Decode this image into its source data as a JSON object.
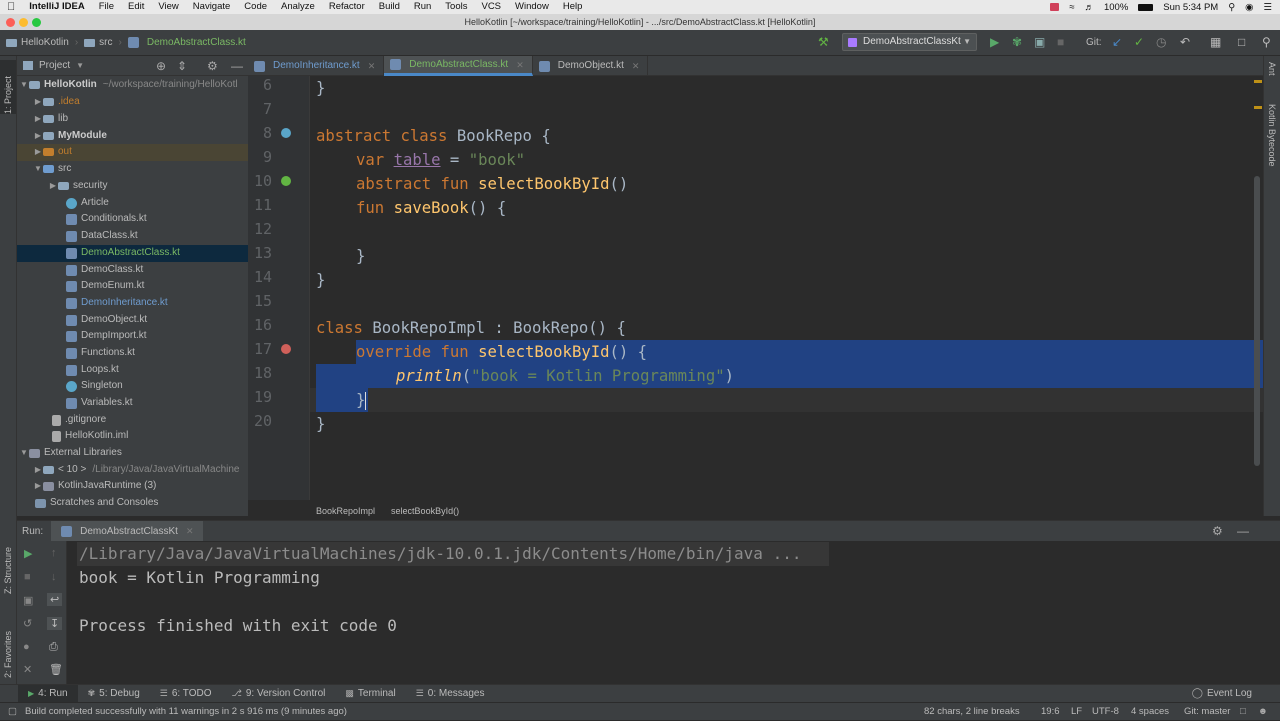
{
  "menubar": {
    "apple": "",
    "items": [
      "IntelliJ IDEA",
      "File",
      "Edit",
      "View",
      "Navigate",
      "Code",
      "Analyze",
      "Refactor",
      "Build",
      "Run",
      "Tools",
      "VCS",
      "Window",
      "Help"
    ],
    "battery": "100%",
    "clock": "Sun 5:34 PM"
  },
  "window_title": "HelloKotlin [~/workspace/training/HelloKotlin] - .../src/DemoAbstractClass.kt [HelloKotlin]",
  "navbar": {
    "crumbs": [
      "HelloKotlin",
      "src",
      "DemoAbstractClass.kt"
    ],
    "run_config": "DemoAbstractClassKt",
    "git_label": "Git:"
  },
  "left_strip": {
    "project": "1: Project",
    "structure": "Z: Structure",
    "favorites": "2: Favorites"
  },
  "right_strip": {
    "ant": "Ant",
    "bytecode": "Kotlin Bytecode"
  },
  "project_panel": {
    "title": "Project",
    "tree": [
      {
        "label": "HelloKotlin",
        "extra": "~/workspace/training/HelloKotl"
      },
      {
        "label": ".idea"
      },
      {
        "label": "lib"
      },
      {
        "label": "MyModule"
      },
      {
        "label": "out"
      },
      {
        "label": "src"
      },
      {
        "label": "security"
      },
      {
        "label": "Article"
      },
      {
        "label": "Conditionals.kt"
      },
      {
        "label": "DataClass.kt"
      },
      {
        "label": "DemoAbstractClass.kt"
      },
      {
        "label": "DemoClass.kt"
      },
      {
        "label": "DemoEnum.kt"
      },
      {
        "label": "DemoInheritance.kt"
      },
      {
        "label": "DemoObject.kt"
      },
      {
        "label": "DempImport.kt"
      },
      {
        "label": "Functions.kt"
      },
      {
        "label": "Loops.kt"
      },
      {
        "label": "Singleton"
      },
      {
        "label": "Variables.kt"
      },
      {
        "label": ".gitignore"
      },
      {
        "label": "HelloKotlin.iml"
      },
      {
        "label": "External Libraries"
      },
      {
        "label": "< 10 >",
        "extra": "/Library/Java/JavaVirtualMachine"
      },
      {
        "label": "KotlinJavaRuntime (3)"
      },
      {
        "label": "Scratches and Consoles"
      }
    ]
  },
  "editor_tabs": [
    "DemoInheritance.kt",
    "DemoAbstractClass.kt",
    "DemoObject.kt"
  ],
  "line_numbers": [
    "6",
    "7",
    "8",
    "9",
    "10",
    "11",
    "12",
    "13",
    "14",
    "15",
    "16",
    "17",
    "18",
    "19",
    "20"
  ],
  "code": {
    "l6": "}",
    "l8_kw": "abstract class ",
    "l8_name": "BookRepo",
    "l8_rest": " {",
    "l9_kw": "var ",
    "l9_prop": "table",
    "l9_eq": " = ",
    "l9_str": "\"book\"",
    "l10_kw": "abstract fun ",
    "l10_fn": "selectBookById",
    "l10_rest": "()",
    "l11_kw": "fun ",
    "l11_fn": "saveBook",
    "l11_rest": "() {",
    "l13": "}",
    "l14": "}",
    "l16_kw": "class ",
    "l16_name": "BookRepoImpl",
    "l16_rest": " : BookRepo() {",
    "l17_kw": "override fun ",
    "l17_fn": "selectBookById",
    "l17_rest": "() {",
    "l18_fn": "println",
    "l18_open": "(",
    "l18_str": "\"book = Kotlin Programming\"",
    "l18_close": ")",
    "l19": "}",
    "l20": "}"
  },
  "editor_breadcrumb": [
    "BookRepoImpl",
    "selectBookById()"
  ],
  "run_panel": {
    "label": "Run:",
    "tab": "DemoAbstractClassKt",
    "output": [
      "/Library/Java/JavaVirtualMachines/jdk-10.0.1.jdk/Contents/Home/bin/java ...",
      "book = Kotlin Programming",
      "",
      "Process finished with exit code 0"
    ]
  },
  "bottom_tabs": [
    "4: Run",
    "5: Debug",
    "6: TODO",
    "9: Version Control",
    "Terminal",
    "0: Messages"
  ],
  "event_log": "Event Log",
  "status": {
    "message": "Build completed successfully with 11 warnings in 2 s 916 ms (9 minutes ago)",
    "chars": "82 chars, 2 line breaks",
    "position": "19:6",
    "line_sep": "LF",
    "encoding": "UTF-8",
    "indent": "4 spaces",
    "git": "Git: master"
  }
}
